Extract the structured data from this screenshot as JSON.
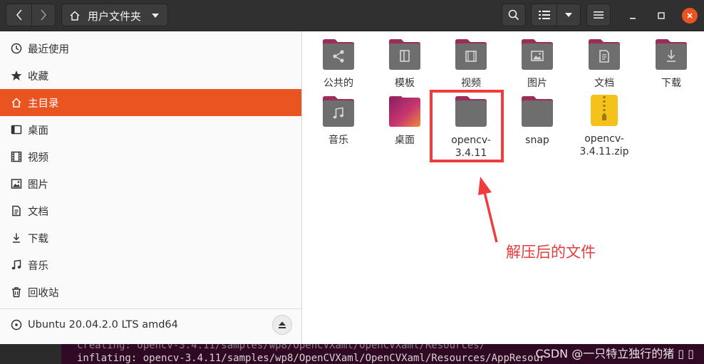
{
  "header": {
    "path_label": "用户文件夹"
  },
  "sidebar": {
    "items": [
      {
        "label": "最近使用"
      },
      {
        "label": "收藏"
      },
      {
        "label": "主目录"
      },
      {
        "label": "桌面"
      },
      {
        "label": "视频"
      },
      {
        "label": "图片"
      },
      {
        "label": "文档"
      },
      {
        "label": "下载"
      },
      {
        "label": "音乐"
      },
      {
        "label": "回收站"
      }
    ],
    "device_label": "Ubuntu 20.04.2.0 LTS amd64"
  },
  "files": [
    {
      "label": "公共的",
      "icon": "share-folder-icon"
    },
    {
      "label": "模板",
      "icon": "template-folder-icon"
    },
    {
      "label": "视频",
      "icon": "video-folder-icon"
    },
    {
      "label": "图片",
      "icon": "picture-folder-icon"
    },
    {
      "label": "文档",
      "icon": "document-folder-icon"
    },
    {
      "label": "下载",
      "icon": "download-folder-icon"
    },
    {
      "label": "音乐",
      "icon": "music-folder-icon"
    },
    {
      "label": "桌面",
      "icon": "desktop-folder-icon"
    },
    {
      "label": "opencv-\n3.4.11",
      "icon": "folder-icon"
    },
    {
      "label": "snap",
      "icon": "folder-icon"
    },
    {
      "label": "opencv-\n3.4.11.zip",
      "icon": "zip-archive-icon"
    }
  ],
  "annotation": {
    "text": "解压后的文件"
  },
  "terminal": {
    "line1": "creating: opencv-3.4.11/samples/wp8/OpenCVXaml/OpenCVXaml/Resources/",
    "line2": "inflating: opencv-3.4.11/samples/wp8/OpenCVXaml/OpenCVXaml/Resources/AppResour"
  },
  "watermark": "CSDN @一只特立独行的猪 ▯ ▯",
  "colors": {
    "accent": "#e95420",
    "folder_tab": "#9b2d5a",
    "folder_body": "#6e6e6e",
    "annotation_red": "#f03c3c"
  }
}
